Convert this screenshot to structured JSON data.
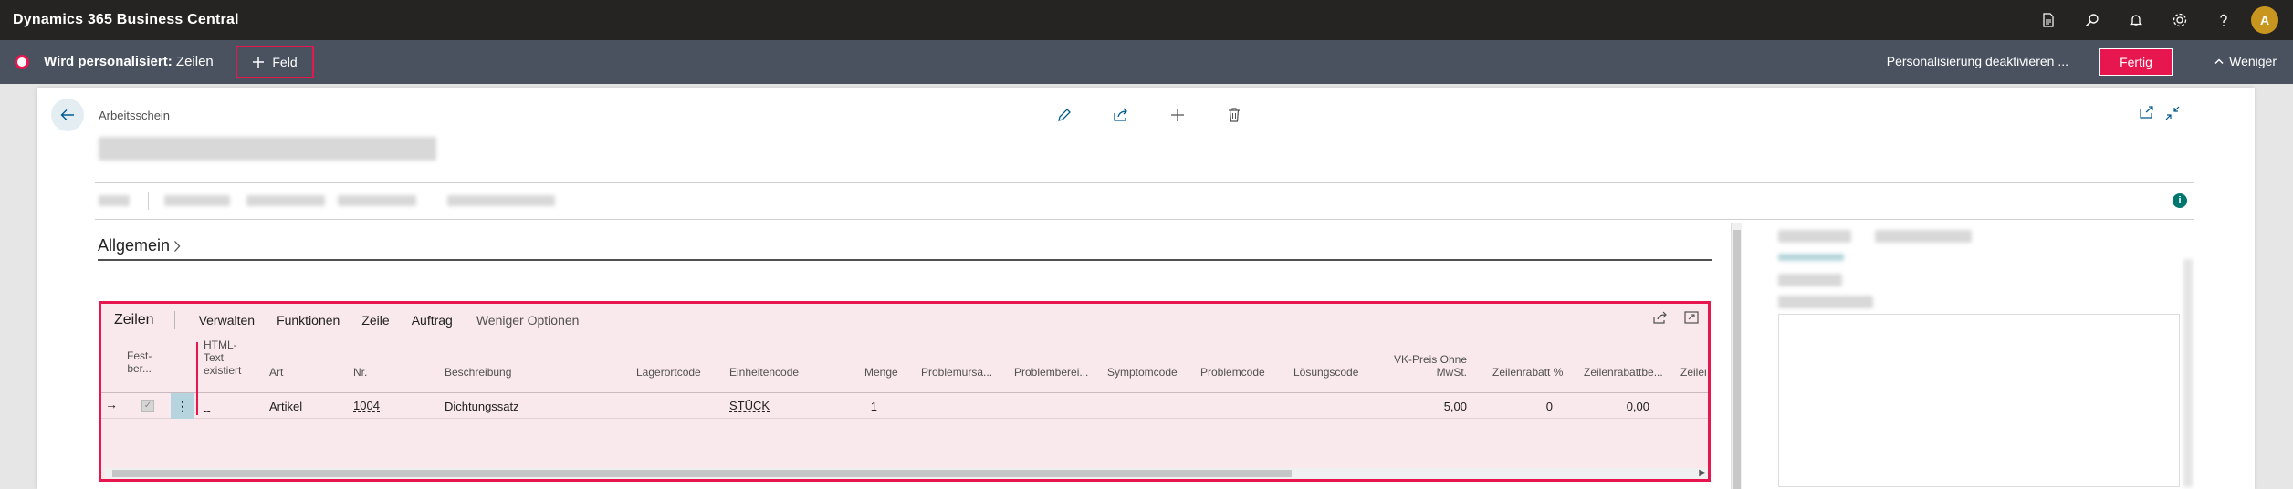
{
  "app": {
    "title": "Dynamics 365 Business Central",
    "avatar_initial": "A"
  },
  "personalization": {
    "status_bold": "Wird personalisiert:",
    "status_context": "Zeilen",
    "add_field_label": "Feld",
    "disable_label": "Personalisierung deaktivieren ...",
    "done_label": "Fertig",
    "less_label": "Weniger"
  },
  "page": {
    "breadcrumb": "Arbeitsschein",
    "section_title": "Allgemein"
  },
  "lines": {
    "title": "Zeilen",
    "actions": [
      "Verwalten",
      "Funktionen",
      "Zeile",
      "Auftrag"
    ],
    "fewer_options": "Weniger Optionen",
    "columns": {
      "fest": "Fest-\nber...",
      "html": "HTML-\nText\nexistiert",
      "art": "Art",
      "nr": "Nr.",
      "beschreibung": "Beschreibung",
      "lagerort": "Lagerortcode",
      "einheit": "Einheitencode",
      "menge": "Menge",
      "problemursache": "Problemursa...",
      "problembereich": "Problemberei...",
      "symptom": "Symptomcode",
      "problem": "Problemcode",
      "loesung": "Lösungscode",
      "vkpreis": "VK-Preis Ohne\nMwSt.",
      "zeilenrabatt_pct": "Zeilenrabatt %",
      "zeilenrabattbetrag": "Zeilenrabattbe...",
      "zeilen": "Zeilen"
    },
    "rows": [
      {
        "html": "_",
        "art": "Artikel",
        "nr": "1004",
        "beschreibung": "Dichtungssatz",
        "einheit": "STÜCK",
        "menge": "1",
        "vkpreis": "5,00",
        "zeilenrabatt_pct": "0",
        "zeilenrabattbetrag": "0,00"
      }
    ]
  },
  "colors": {
    "accent": "#e8164f",
    "appbar": "#252423",
    "personalization_bar": "#4a5260"
  },
  "icons": [
    "document-icon",
    "search-icon",
    "bell-icon",
    "gear-icon",
    "help-icon",
    "edit-icon",
    "share-icon",
    "add-icon",
    "delete-icon",
    "open-new-window-icon",
    "collapse-icon",
    "info-icon",
    "back-arrow-icon",
    "chevron-right-icon",
    "chevron-up-icon"
  ]
}
